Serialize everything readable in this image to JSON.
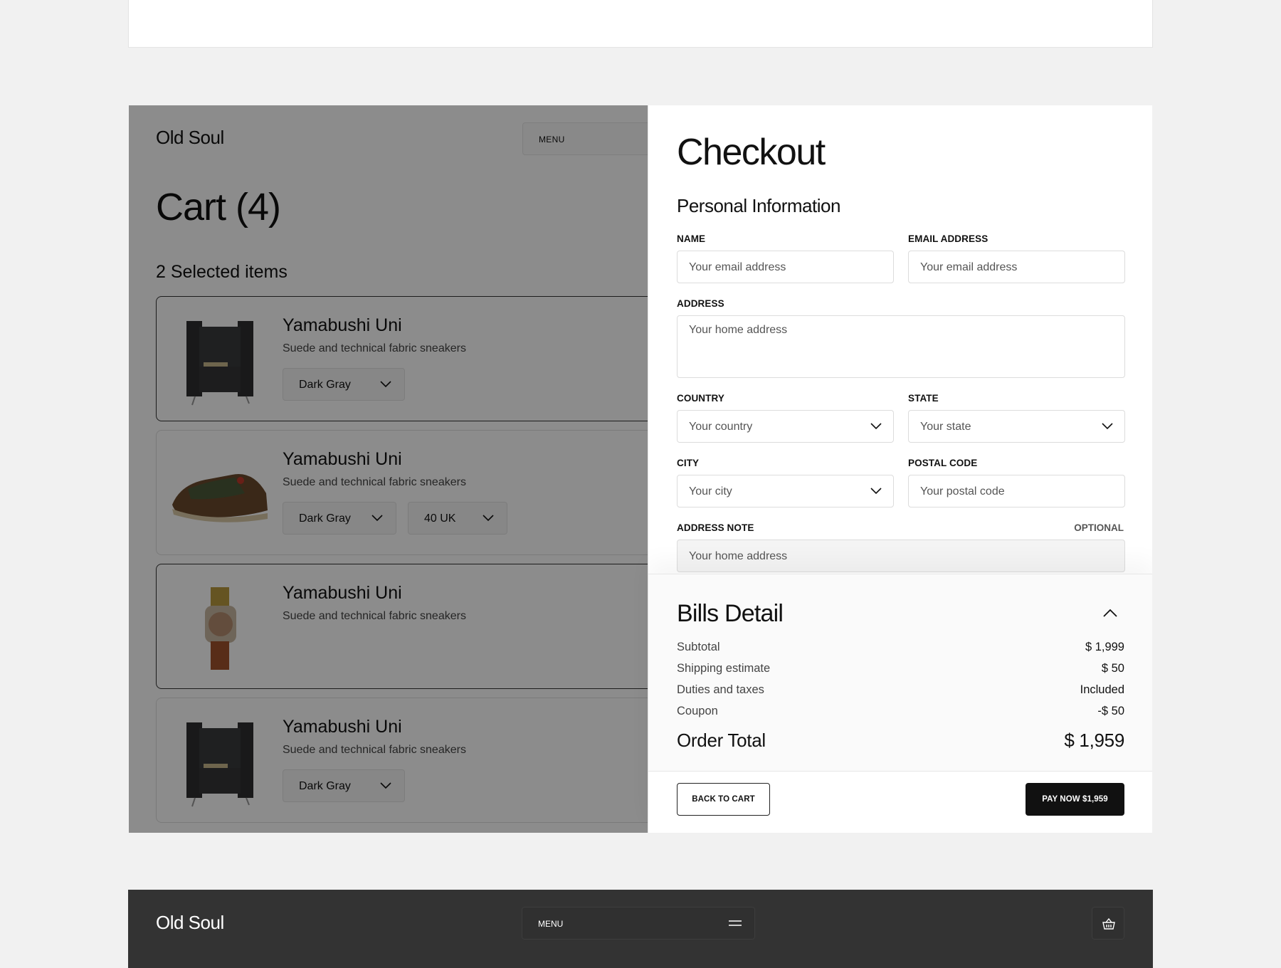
{
  "brand": "Old Soul",
  "menu_label": "MENU",
  "cart": {
    "title": "Cart  (4)",
    "selected": "2 Selected items",
    "items": [
      {
        "name": "Yamabushi Uni",
        "desc": "Suede and technical fabric sneakers",
        "color": "Dark Gray",
        "image": "armchair"
      },
      {
        "name": "Yamabushi Uni",
        "desc": "Suede and technical fabric sneakers",
        "color": "Dark Gray",
        "size": "40 UK",
        "image": "sneaker"
      },
      {
        "name": "Yamabushi Uni",
        "desc": "Suede and technical fabric sneakers",
        "image": "watch"
      },
      {
        "name": "Yamabushi Uni",
        "desc": "Suede and technical fabric sneakers",
        "color": "Dark Gray",
        "image": "armchair"
      }
    ]
  },
  "checkout": {
    "title": "Checkout",
    "section": "Personal Information",
    "fields": {
      "name": {
        "label": "NAME",
        "placeholder": "Your email address"
      },
      "email": {
        "label": "EMAIL ADDRESS",
        "placeholder": "Your email address"
      },
      "address": {
        "label": "ADDRESS",
        "placeholder": "Your home address"
      },
      "country": {
        "label": "COUNTRY",
        "placeholder": "Your country"
      },
      "state": {
        "label": "STATE",
        "placeholder": "Your state"
      },
      "city": {
        "label": "CITY",
        "placeholder": "Your city"
      },
      "postal": {
        "label": "POSTAL CODE",
        "placeholder": "Your postal code"
      },
      "note": {
        "label": "ADDRESS NOTE",
        "optional": "OPTIONAL",
        "placeholder": "Your home address"
      }
    }
  },
  "bills": {
    "title": "Bills Detail",
    "rows": [
      {
        "label": "Subtotal",
        "value": "$ 1,999"
      },
      {
        "label": "Shipping estimate",
        "value": "$ 50"
      },
      {
        "label": "Duties and taxes",
        "value": "Included"
      },
      {
        "label": "Coupon",
        "value": "-$ 50"
      }
    ],
    "total_label": "Order Total",
    "total_value": "$ 1,959",
    "back_label": "BACK TO CART",
    "pay_label": "PAY NOW $1,959"
  },
  "colors": {
    "overlay": "#000000",
    "button_dark": "#111111",
    "dark_header": "#333333"
  }
}
